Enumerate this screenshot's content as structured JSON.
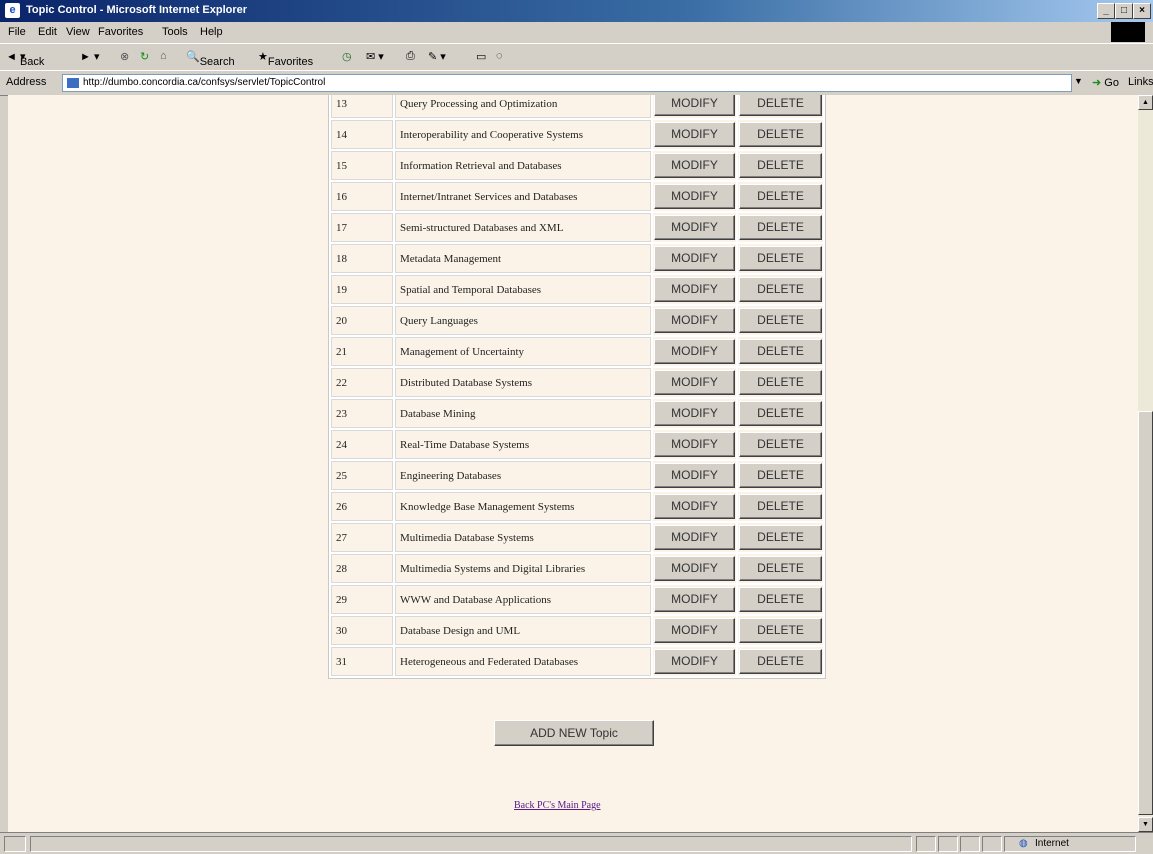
{
  "window": {
    "title": "Topic Control - Microsoft Internet Explorer"
  },
  "menu": [
    "File",
    "Edit",
    "View",
    "Favorites",
    "Tools",
    "Help"
  ],
  "toolbar": {
    "back": "Back",
    "search": "Search",
    "favorites": "Favorites"
  },
  "address": {
    "label": "Address",
    "url": "http://dumbo.concordia.ca/confsys/servlet/TopicControl",
    "go": "Go",
    "links": "Links"
  },
  "table": {
    "partial_row": {
      "num": "13",
      "name": "Query Processing and Optimization"
    },
    "rows": [
      {
        "num": "14",
        "name": "Interoperability and Cooperative Systems"
      },
      {
        "num": "15",
        "name": "Information Retrieval and Databases"
      },
      {
        "num": "16",
        "name": "Internet/Intranet Services and Databases"
      },
      {
        "num": "17",
        "name": "Semi-structured Databases and XML"
      },
      {
        "num": "18",
        "name": "Metadata Management"
      },
      {
        "num": "19",
        "name": "Spatial and Temporal Databases"
      },
      {
        "num": "20",
        "name": "Query Languages"
      },
      {
        "num": "21",
        "name": "Management of Uncertainty"
      },
      {
        "num": "22",
        "name": "Distributed Database Systems"
      },
      {
        "num": "23",
        "name": "Database Mining"
      },
      {
        "num": "24",
        "name": "Real-Time Database Systems"
      },
      {
        "num": "25",
        "name": "Engineering Databases"
      },
      {
        "num": "26",
        "name": "Knowledge Base Management Systems"
      },
      {
        "num": "27",
        "name": "Multimedia Database Systems"
      },
      {
        "num": "28",
        "name": "Multimedia Systems and Digital Libraries"
      },
      {
        "num": "29",
        "name": "WWW and Database Applications"
      },
      {
        "num": "30",
        "name": "Database Design and UML"
      },
      {
        "num": "31",
        "name": "Heterogeneous and Federated Databases"
      }
    ],
    "modify_label": "MODIFY",
    "delete_label": "DELETE"
  },
  "add_button": "ADD NEW Topic",
  "back_link": "Back PC's Main Page",
  "status": {
    "zone": "Internet"
  }
}
